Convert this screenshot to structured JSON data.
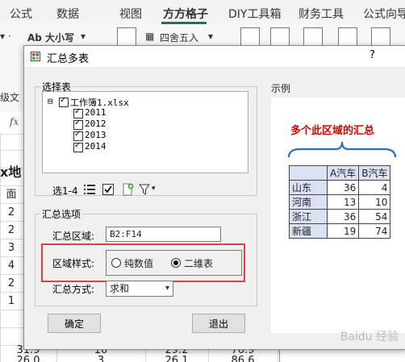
{
  "ribbon": {
    "tabs": [
      "公式",
      "数据",
      "视图",
      "方方格子",
      "DIY工具箱",
      "财务工具",
      "公式向导"
    ],
    "active_tab": "方方格子",
    "items": {
      "font_size_label": "Ab 大小写",
      "round_label": "四舍五入",
      "left_edge_label": "级文",
      "fx_label": "fx"
    }
  },
  "sheet": {
    "left_partial": [
      "x地",
      "面",
      "2",
      "2",
      "3",
      "4",
      "2",
      "1"
    ],
    "last_row": [
      "31.9",
      "10",
      "29.2",
      "76.9"
    ],
    "cutoff_row": [
      "26.0",
      "3",
      "26.1",
      "86.6"
    ]
  },
  "dialog": {
    "title": "汇总多表",
    "help": "?",
    "select_group": {
      "label": "选择表",
      "workbook": "工作簿1.xlsx",
      "sheets": [
        "2011",
        "2012",
        "2013",
        "2014"
      ],
      "select_range_label": "选1-4"
    },
    "options_group": {
      "label": "汇总选项",
      "area_label": "汇总区域:",
      "area_value": "B2:F14",
      "style_label": "区域样式:",
      "style_options": [
        "纯数值",
        "二维表"
      ],
      "style_selected": "二维表",
      "method_label": "汇总方式:",
      "method_value": "求和"
    },
    "buttons": {
      "ok": "确定",
      "exit": "退出"
    },
    "example": {
      "label": "示例",
      "caption": "多个此区域的汇总",
      "header": [
        "",
        "A汽车",
        "B汽车"
      ],
      "rows": [
        [
          "山东",
          "36",
          "4"
        ],
        [
          "河南",
          "13",
          "10"
        ],
        [
          "浙江",
          "36",
          "54"
        ],
        [
          "新疆",
          "19",
          "74"
        ]
      ]
    }
  },
  "watermark": "Baidu 经验",
  "colors": {
    "highlight": "#e04040",
    "caption": "#e00000",
    "accent": "#217346"
  }
}
